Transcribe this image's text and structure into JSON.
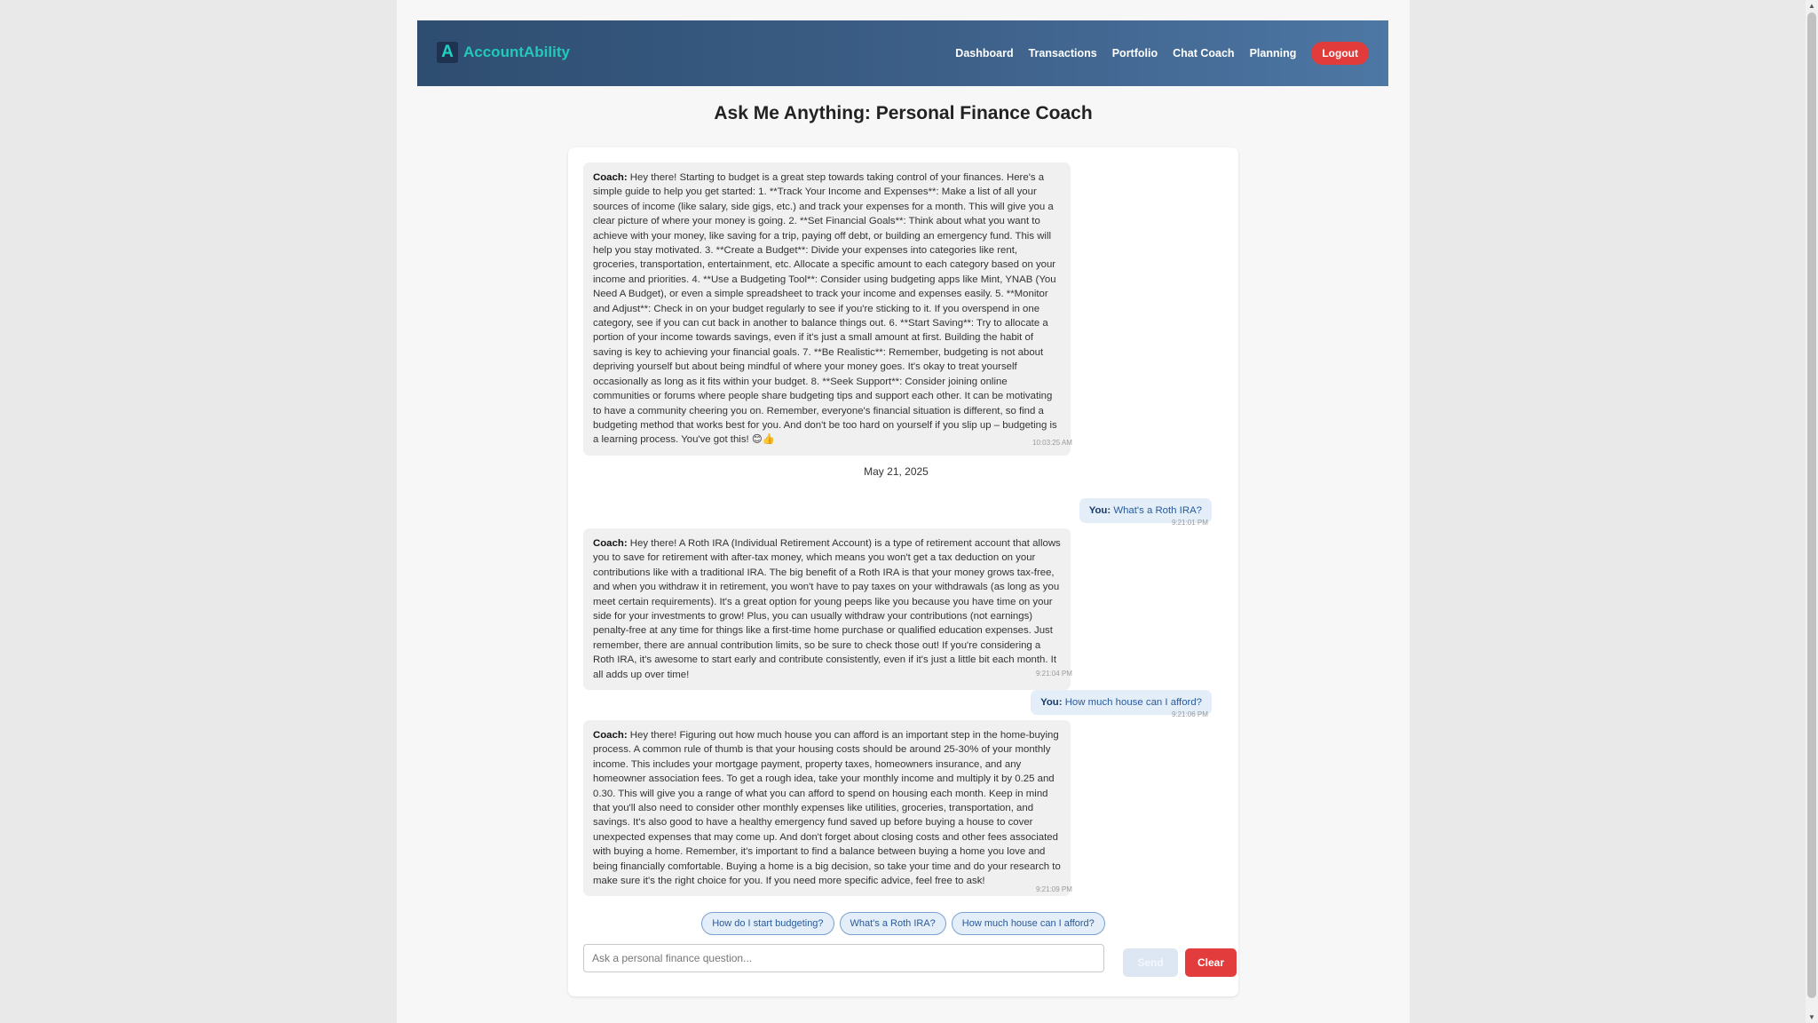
{
  "brand": {
    "logo_letter": "A",
    "name": "AccountAbility"
  },
  "nav": {
    "links": [
      "Dashboard",
      "Transactions",
      "Portfolio",
      "Chat Coach",
      "Planning"
    ],
    "logout_label": "Logout"
  },
  "page_title": "Ask Me Anything: Personal Finance Coach",
  "chat": {
    "messages": [
      {
        "sender": "Coach",
        "text": "Hey there! Starting to budget is a great step towards taking control of your finances. Here's a simple guide to help you get started: 1. **Track Your Income and Expenses**: Make a list of all your sources of income (like salary, side gigs, etc.) and track your expenses for a month. This will give you a clear picture of where your money is going. 2. **Set Financial Goals**: Think about what you want to achieve with your money, like saving for a trip, paying off debt, or building an emergency fund. This will help you stay motivated. 3. **Create a Budget**: Divide your expenses into categories like rent, groceries, transportation, entertainment, etc. Allocate a specific amount to each category based on your income and priorities. 4. **Use a Budgeting Tool**: Consider using budgeting apps like Mint, YNAB (You Need A Budget), or even a simple spreadsheet to track your income and expenses easily. 5. **Monitor and Adjust**: Check in on your budget regularly to see if you're sticking to it. If you overspend in one category, see if you can cut back in another to balance things out. 6. **Start Saving**: Try to allocate a portion of your income towards savings, even if it's just a small amount at first. Building the habit of saving is key to achieving your financial goals. 7. **Be Realistic**: Remember, budgeting is not about depriving yourself but about being mindful of where your money goes. It's okay to treat yourself occasionally as long as it fits within your budget. 8. **Seek Support**: Consider joining online communities or forums where people share budgeting tips and support each other. It can be motivating to have a community cheering you on. Remember, everyone's financial situation is different, so find a budgeting method that works best for you. And don't be too hard on yourself if you slip up – budgeting is a learning process. You've got this! 😊👍",
        "time": "10:03:25 AM"
      },
      {
        "date_divider": "May 21, 2025"
      },
      {
        "sender": "You",
        "text": "What's a Roth IRA?",
        "time": "9:21:01 PM"
      },
      {
        "sender": "Coach",
        "text": "Hey there! A Roth IRA (Individual Retirement Account) is a type of retirement account that allows you to save for retirement with after-tax money, which means you won't get a tax deduction on your contributions like with a traditional IRA. The big benefit of a Roth IRA is that your money grows tax-free, and when you withdraw it in retirement, you won't have to pay taxes on your withdrawals (as long as you meet certain requirements). It's a great option for young peeps like you because you have time on your side for your investments to grow! Plus, you can usually withdraw your contributions (not earnings) penalty-free at any time for things like a first-time home purchase or qualified education expenses. Just remember, there are annual contribution limits, so be sure to check those out! If you're considering a Roth IRA, it's awesome to start early and contribute consistently, even if it's just a little bit each month. It all adds up over time!",
        "time": "9:21:04 PM"
      },
      {
        "sender": "You",
        "text": "How much house can I afford?",
        "time": "9:21:06 PM"
      },
      {
        "sender": "Coach",
        "text": "Hey there! Figuring out how much house you can afford is an important step in the home-buying process. A common rule of thumb is that your housing costs should be around 25-30% of your monthly income. This includes your mortgage payment, property taxes, homeowners insurance, and any homeowner association fees. To get a rough idea, take your monthly income and multiply it by 0.25 and 0.30. This will give you a range of what you can afford to spend on housing each month. Keep in mind that you'll also need to consider other monthly expenses like utilities, groceries, transportation, and savings. It's also good to have a healthy emergency fund saved up before buying a house to cover unexpected expenses that may come up. And don't forget about closing costs and other fees associated with buying a home. Remember, it's important to find a balance between buying a home you love and being financially comfortable. Buying a home is a big decision, so take your time and do your research to make sure it's the right choice for you. If you need more specific advice, feel free to ask!",
        "time": "9:21:09 PM"
      }
    ]
  },
  "suggestions": [
    "How do I start budgeting?",
    "What's a Roth IRA?",
    "How much house can I afford?"
  ],
  "input": {
    "placeholder": "Ask a personal finance question...",
    "value": ""
  },
  "buttons": {
    "send": "Send",
    "clear": "Clear"
  },
  "colors": {
    "navbar_start": "#2e4d70",
    "navbar_end": "#4d77a4",
    "brand_accent": "#22c9b9",
    "danger": "#e33c3c"
  }
}
